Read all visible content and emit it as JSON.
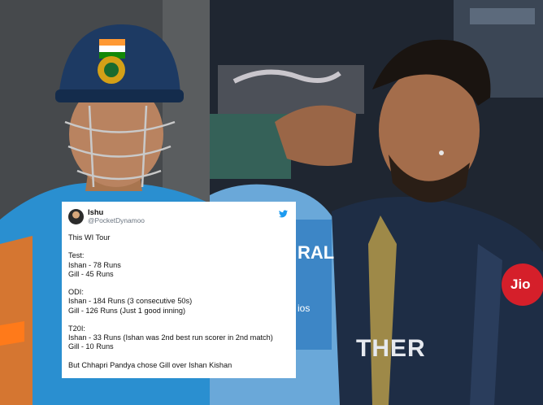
{
  "images": {
    "left_photo": "Cricketer in blue India helmet and jersey",
    "right_photo": "Two cricketers in navy team jerseys embracing"
  },
  "tweet": {
    "display_name": "Ishu",
    "handle": "@PocketDynamoo",
    "icon": "twitter-bird-icon",
    "lines": [
      "This WI Tour",
      "",
      "Test:",
      "Ishan - 78 Runs",
      "Gill - 45 Runs",
      "",
      "ODI:",
      "Ishan - 184 Runs (3 consecutive 50s)",
      "Gill - 126 Runs (Just 1 good inning)",
      "",
      "T20I:",
      "Ishan - 33 Runs (Ishan was 2nd best run scorer in 2nd match)",
      "Gill - 10 Runs",
      "",
      "But Chhapri Pandya chose Gill over Ishan Kishan"
    ]
  },
  "jersey_text": {
    "left_sleeve": "RAL",
    "chest": "THER",
    "sponsor": "Jio",
    "sponsor2": "ios"
  },
  "colors": {
    "twitter_blue": "#1d9bf0",
    "india_blue": "#2a8fd0",
    "team_navy": "#1e2d45"
  }
}
